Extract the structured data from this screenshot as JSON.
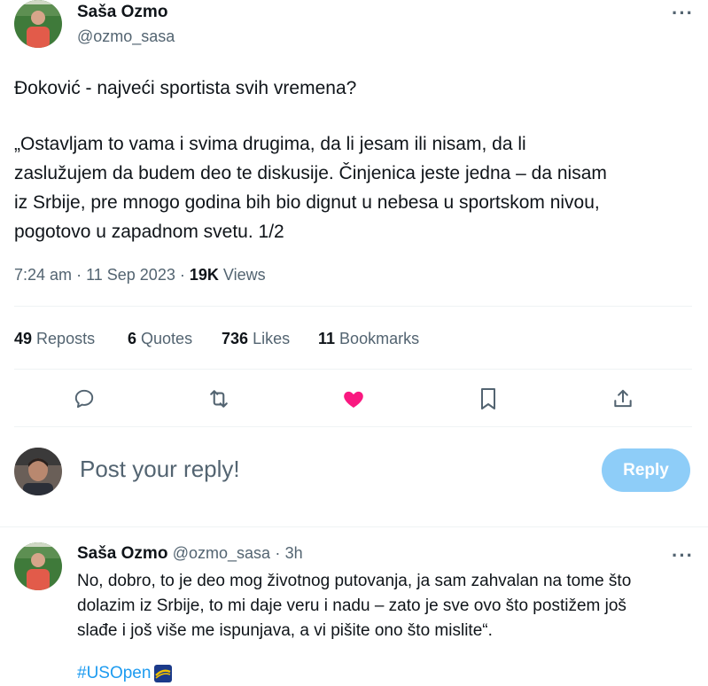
{
  "tweet": {
    "author_name": "Saša Ozmo",
    "author_handle": "@ozmo_sasa",
    "more_label": "···",
    "text_line1": "Đoković - najveći sportista svih vremena?",
    "text_para2": [
      "„Ostavljam to vama i svima drugima, da li jesam ili nisam, da li",
      "zaslužujem da budem deo te diskusije. Činjenica jeste jedna – da nisam",
      "iz Srbije, pre mnogo godina bih bio dignut u nebesa u sportskom nivou,",
      "pogotovo u zapadnom svetu. 1/2"
    ],
    "time": "7:24 am",
    "date": "11 Sep 2023",
    "views_count": "19K",
    "views_label": "Views",
    "sep": "·"
  },
  "stats": [
    {
      "count": "49",
      "label": "Reposts"
    },
    {
      "count": "6",
      "label": "Quotes"
    },
    {
      "count": "736",
      "label": "Likes"
    },
    {
      "count": "11",
      "label": "Bookmarks"
    }
  ],
  "actions": [
    "reply-icon",
    "repost-icon",
    "like-icon",
    "bookmark-icon",
    "share-icon"
  ],
  "colors": {
    "like": "#f91880",
    "reply_button": "#8ecdf8",
    "link": "#1d9bf0",
    "muted": "#536471"
  },
  "composer": {
    "placeholder": "Post your reply!",
    "reply_button": "Reply"
  },
  "reply": {
    "author_name": "Saša Ozmo",
    "author_handle": "@ozmo_sasa",
    "sep": "·",
    "time_ago": "3h",
    "more_label": "···",
    "lines": [
      "No, dobro, to je deo mog životnog putovanja, ja sam zahvalan na tome što",
      "dolazim iz Srbije, to mi daje veru i nadu – zato je sve ovo što postižem još",
      "slađe i još više me ispunjava, a vi pišite ono što mislite“."
    ],
    "hashtag": "#USOpen"
  }
}
